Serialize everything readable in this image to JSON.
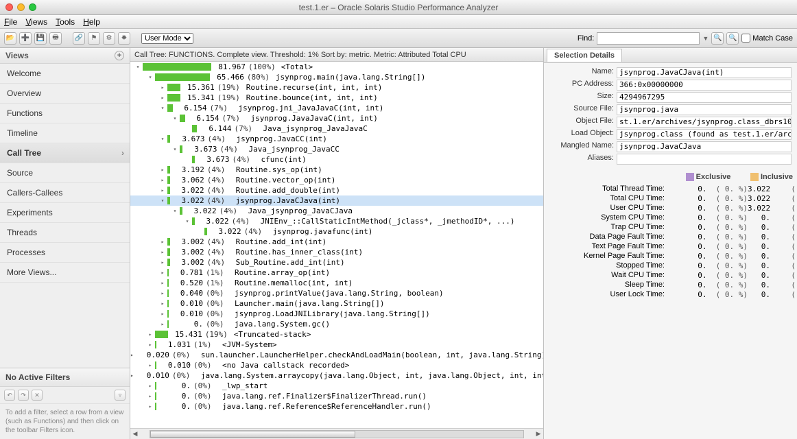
{
  "window": {
    "title": "test.1.er  –  Oracle Solaris Studio Performance Analyzer"
  },
  "menubar": [
    "File",
    "Views",
    "Tools",
    "Help"
  ],
  "toolbar": {
    "mode_label": "User Mode",
    "find_label": "Find:",
    "find_value": "",
    "matchcase_label": "Match Case"
  },
  "sidebar": {
    "title": "Views",
    "items": [
      "Welcome",
      "Overview",
      "Functions",
      "Timeline",
      "Call Tree",
      "Source",
      "Callers-Callees",
      "Experiments",
      "Threads",
      "Processes",
      "More Views..."
    ],
    "selected_index": 4
  },
  "filters": {
    "title": "No Active Filters",
    "help": "To add a filter, select a row from a view (such as Functions) and then click on the toolbar Filters icon."
  },
  "calltree": {
    "header": "Call Tree: FUNCTIONS.   Complete view.   Threshold: 1%   Sort by: metric.   Metric: Attributed Total CPU",
    "max": 81.967,
    "rows": [
      {
        "depth": 0,
        "tgl": "open",
        "val": "81.967",
        "pct": "(100%)",
        "fn": "<Total>"
      },
      {
        "depth": 1,
        "tgl": "open",
        "val": "65.466",
        "pct": "(80%)",
        "fn": "jsynprog.main(java.lang.String[])"
      },
      {
        "depth": 2,
        "tgl": "closed",
        "val": "15.361",
        "pct": "(19%)",
        "fn": "Routine.recurse(int, int, int)"
      },
      {
        "depth": 2,
        "tgl": "closed",
        "val": "15.341",
        "pct": "(19%)",
        "fn": "Routine.bounce(int, int, int)"
      },
      {
        "depth": 2,
        "tgl": "open",
        "val": "6.154",
        "pct": "(7%)",
        "fn": "jsynprog.jni_JavaJavaC(int, int)"
      },
      {
        "depth": 3,
        "tgl": "open",
        "val": "6.154",
        "pct": "(7%)",
        "fn": "jsynprog.JavaJavaC(int, int)"
      },
      {
        "depth": 4,
        "tgl": "leaf",
        "val": "6.144",
        "pct": "(7%)",
        "fn": "Java_jsynprog_JavaJavaC"
      },
      {
        "depth": 2,
        "tgl": "open",
        "val": "3.673",
        "pct": "(4%)",
        "fn": "jsynprog.JavaCC(int)"
      },
      {
        "depth": 3,
        "tgl": "open",
        "val": "3.673",
        "pct": "(4%)",
        "fn": "Java_jsynprog_JavaCC"
      },
      {
        "depth": 4,
        "tgl": "leaf",
        "val": "3.673",
        "pct": "(4%)",
        "fn": "cfunc(int)"
      },
      {
        "depth": 2,
        "tgl": "closed",
        "val": "3.192",
        "pct": "(4%)",
        "fn": "Routine.sys_op(int)"
      },
      {
        "depth": 2,
        "tgl": "closed",
        "val": "3.062",
        "pct": "(4%)",
        "fn": "Routine.vector_op(int)"
      },
      {
        "depth": 2,
        "tgl": "closed",
        "val": "3.022",
        "pct": "(4%)",
        "fn": "Routine.add_double(int)"
      },
      {
        "depth": 2,
        "tgl": "open",
        "val": "3.022",
        "pct": "(4%)",
        "fn": "jsynprog.JavaCJava(int)",
        "sel": true
      },
      {
        "depth": 3,
        "tgl": "open",
        "val": "3.022",
        "pct": "(4%)",
        "fn": "Java_jsynprog_JavaCJava"
      },
      {
        "depth": 4,
        "tgl": "open",
        "val": "3.022",
        "pct": "(4%)",
        "fn": "JNIEnv_::CallStaticIntMethod(_jclass*, _jmethodID*, ...)"
      },
      {
        "depth": 5,
        "tgl": "leaf",
        "val": "3.022",
        "pct": "(4%)",
        "fn": "jsynprog.javafunc(int)"
      },
      {
        "depth": 2,
        "tgl": "closed",
        "val": "3.002",
        "pct": "(4%)",
        "fn": "Routine.add_int(int)"
      },
      {
        "depth": 2,
        "tgl": "closed",
        "val": "3.002",
        "pct": "(4%)",
        "fn": "Routine.has_inner_class(int)"
      },
      {
        "depth": 2,
        "tgl": "closed",
        "val": "3.002",
        "pct": "(4%)",
        "fn": "Sub_Routine.add_int(int)"
      },
      {
        "depth": 2,
        "tgl": "closed",
        "val": "0.781",
        "pct": "(1%)",
        "fn": "Routine.array_op(int)"
      },
      {
        "depth": 2,
        "tgl": "closed",
        "val": "0.520",
        "pct": "(1%)",
        "fn": "Routine.memalloc(int, int)"
      },
      {
        "depth": 2,
        "tgl": "closed",
        "val": "0.040",
        "pct": "(0%)",
        "fn": "jsynprog.printValue(java.lang.String, boolean)"
      },
      {
        "depth": 2,
        "tgl": "closed",
        "val": "0.010",
        "pct": "(0%)",
        "fn": "Launcher.main(java.lang.String[])"
      },
      {
        "depth": 2,
        "tgl": "closed",
        "val": "0.010",
        "pct": "(0%)",
        "fn": "jsynprog.LoadJNILibrary(java.lang.String[])"
      },
      {
        "depth": 2,
        "tgl": "closed",
        "val": "0.",
        "pct": "(0%)",
        "fn": "java.lang.System.gc()"
      },
      {
        "depth": 1,
        "tgl": "closed",
        "val": "15.431",
        "pct": "(19%)",
        "fn": "<Truncated-stack>"
      },
      {
        "depth": 1,
        "tgl": "closed",
        "val": "1.031",
        "pct": "(1%)",
        "fn": "<JVM-System>"
      },
      {
        "depth": 1,
        "tgl": "closed",
        "val": "0.020",
        "pct": "(0%)",
        "fn": "sun.launcher.LauncherHelper.checkAndLoadMain(boolean, int, java.lang.String)"
      },
      {
        "depth": 1,
        "tgl": "closed",
        "val": "0.010",
        "pct": "(0%)",
        "fn": "<no Java callstack recorded>"
      },
      {
        "depth": 1,
        "tgl": "closed",
        "val": "0.010",
        "pct": "(0%)",
        "fn": "java.lang.System.arraycopy(java.lang.Object, int, java.lang.Object, int, int)"
      },
      {
        "depth": 1,
        "tgl": "closed",
        "val": "0.",
        "pct": "(0%)",
        "fn": "_lwp_start"
      },
      {
        "depth": 1,
        "tgl": "closed",
        "val": "0.",
        "pct": "(0%)",
        "fn": "java.lang.ref.Finalizer$FinalizerThread.run()"
      },
      {
        "depth": 1,
        "tgl": "closed",
        "val": "0.",
        "pct": "(0%)",
        "fn": "java.lang.ref.Reference$ReferenceHandler.run()"
      }
    ]
  },
  "selection": {
    "tab_label": "Selection Details",
    "fields": [
      {
        "label": "Name:",
        "value": "jsynprog.JavaCJava(int)"
      },
      {
        "label": "PC Address:",
        "value": "366:0x00000000"
      },
      {
        "label": "Size:",
        "value": "4294967295"
      },
      {
        "label": "Source File:",
        "value": "jsynprog.java"
      },
      {
        "label": "Object File:",
        "value": "st.1.er/archives/jsynprog.class_dbrs10"
      },
      {
        "label": "Load Object:",
        "value": "jsynprog.class (found as test.1.er/arc"
      },
      {
        "label": "Mangled Name:",
        "value": "jsynprog.JavaCJava"
      },
      {
        "label": "Aliases:",
        "value": ""
      }
    ],
    "metric_headers": {
      "excl": "Exclusive",
      "incl": "Inclusive"
    },
    "metrics": [
      {
        "name": "Total Thread Time:",
        "ev": "0.",
        "ep": "(   0.  %)",
        "iv": "3.022",
        "ip": "("
      },
      {
        "name": "Total CPU Time:",
        "ev": "0.",
        "ep": "(   0.  %)",
        "iv": "3.022",
        "ip": "("
      },
      {
        "name": "User CPU Time:",
        "ev": "0.",
        "ep": "(   0.  %)",
        "iv": "3.022",
        "ip": "("
      },
      {
        "name": "System CPU Time:",
        "ev": "0.",
        "ep": "(   0.  %)",
        "iv": "0.",
        "ip": "("
      },
      {
        "name": "Trap CPU Time:",
        "ev": "0.",
        "ep": "(   0.  %)",
        "iv": "0.",
        "ip": "("
      },
      {
        "name": "Data Page Fault Time:",
        "ev": "0.",
        "ep": "(   0.  %)",
        "iv": "0.",
        "ip": "("
      },
      {
        "name": "Text Page Fault Time:",
        "ev": "0.",
        "ep": "(   0.  %)",
        "iv": "0.",
        "ip": "("
      },
      {
        "name": "Kernel Page Fault Time:",
        "ev": "0.",
        "ep": "(   0.  %)",
        "iv": "0.",
        "ip": "("
      },
      {
        "name": "Stopped Time:",
        "ev": "0.",
        "ep": "(   0.  %)",
        "iv": "0.",
        "ip": "("
      },
      {
        "name": "Wait CPU Time:",
        "ev": "0.",
        "ep": "(   0.  %)",
        "iv": "0.",
        "ip": "("
      },
      {
        "name": "Sleep Time:",
        "ev": "0.",
        "ep": "(   0.  %)",
        "iv": "0.",
        "ip": "("
      },
      {
        "name": "User Lock Time:",
        "ev": "0.",
        "ep": "(   0.  %)",
        "iv": "0.",
        "ip": "("
      }
    ]
  }
}
